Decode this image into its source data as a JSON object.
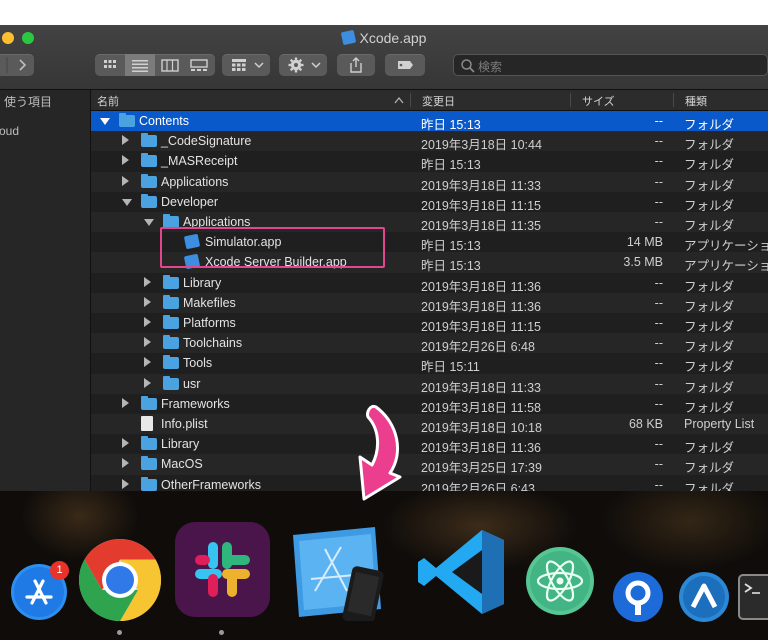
{
  "window": {
    "title": "Xcode.app",
    "search_placeholder": "検索",
    "sidebar": [
      {
        "label": "使う項目"
      },
      {
        "label": "oud"
      }
    ],
    "columns": {
      "name": "名前",
      "date": "変更日",
      "size": "サイズ",
      "kind": "種類"
    }
  },
  "rows": [
    {
      "name": "Contents",
      "date": "昨日 15:13",
      "size": "--",
      "kind": "フォルダ",
      "level": 0,
      "icon": "folder-icon",
      "state": "open",
      "selected": true
    },
    {
      "name": "_CodeSignature",
      "date": "2019年3月18日 10:44",
      "size": "--",
      "kind": "フォルダ",
      "level": 1,
      "icon": "folder-icon",
      "state": "closed"
    },
    {
      "name": "_MASReceipt",
      "date": "昨日 15:13",
      "size": "--",
      "kind": "フォルダ",
      "level": 1,
      "icon": "folder-icon",
      "state": "closed"
    },
    {
      "name": "Applications",
      "date": "2019年3月18日 11:33",
      "size": "--",
      "kind": "フォルダ",
      "level": 1,
      "icon": "folder-icon",
      "state": "closed"
    },
    {
      "name": "Developer",
      "date": "2019年3月18日 11:15",
      "size": "--",
      "kind": "フォルダ",
      "level": 1,
      "icon": "folder-icon",
      "state": "open"
    },
    {
      "name": "Applications",
      "date": "2019年3月18日 11:35",
      "size": "--",
      "kind": "フォルダ",
      "level": 2,
      "icon": "folder-icon",
      "state": "open"
    },
    {
      "name": "Simulator.app",
      "date": "昨日 15:13",
      "size": "14 MB",
      "kind": "アプリケーション",
      "level": 3,
      "icon": "app-icon",
      "state": "none"
    },
    {
      "name": "Xcode Server Builder.app",
      "date": "昨日 15:13",
      "size": "3.5 MB",
      "kind": "アプリケーション",
      "level": 3,
      "icon": "app-icon",
      "state": "none"
    },
    {
      "name": "Library",
      "date": "2019年3月18日 11:36",
      "size": "--",
      "kind": "フォルダ",
      "level": 2,
      "icon": "folder-icon",
      "state": "closed"
    },
    {
      "name": "Makefiles",
      "date": "2019年3月18日 11:36",
      "size": "--",
      "kind": "フォルダ",
      "level": 2,
      "icon": "folder-icon",
      "state": "closed"
    },
    {
      "name": "Platforms",
      "date": "2019年3月18日 11:15",
      "size": "--",
      "kind": "フォルダ",
      "level": 2,
      "icon": "folder-icon",
      "state": "closed"
    },
    {
      "name": "Toolchains",
      "date": "2019年2月26日 6:48",
      "size": "--",
      "kind": "フォルダ",
      "level": 2,
      "icon": "folder-icon",
      "state": "closed"
    },
    {
      "name": "Tools",
      "date": "昨日 15:11",
      "size": "--",
      "kind": "フォルダ",
      "level": 2,
      "icon": "folder-icon",
      "state": "closed"
    },
    {
      "name": "usr",
      "date": "2019年3月18日 11:33",
      "size": "--",
      "kind": "フォルダ",
      "level": 2,
      "icon": "folder-icon",
      "state": "closed"
    },
    {
      "name": "Frameworks",
      "date": "2019年3月18日 11:58",
      "size": "--",
      "kind": "フォルダ",
      "level": 1,
      "icon": "folder-icon",
      "state": "closed"
    },
    {
      "name": "Info.plist",
      "date": "2019年3月18日 10:18",
      "size": "68 KB",
      "kind": "Property List",
      "level": 1,
      "icon": "document-icon",
      "state": "none"
    },
    {
      "name": "Library",
      "date": "2019年3月18日 11:36",
      "size": "--",
      "kind": "フォルダ",
      "level": 1,
      "icon": "folder-icon",
      "state": "closed"
    },
    {
      "name": "MacOS",
      "date": "2019年3月25日 17:39",
      "size": "--",
      "kind": "フォルダ",
      "level": 1,
      "icon": "folder-icon",
      "state": "closed"
    },
    {
      "name": "OtherFrameworks",
      "date": "2019年2月26日 6:43",
      "size": "--",
      "kind": "フォルダ",
      "level": 1,
      "icon": "folder-icon",
      "state": "closed"
    }
  ],
  "dock": {
    "app_store_badge": "1",
    "items": [
      {
        "name": "app-store-icon"
      },
      {
        "name": "chrome-icon"
      },
      {
        "name": "slack-icon"
      },
      {
        "name": "xcode-icon"
      },
      {
        "name": "vscode-icon"
      },
      {
        "name": "atom-icon"
      },
      {
        "name": "sourcetree-icon"
      },
      {
        "name": "arrow-app-icon"
      },
      {
        "name": "terminal-icon"
      }
    ]
  },
  "colors": {
    "selection": "#0a59cb",
    "highlight_box": "#e2468c",
    "arrow": "#ec3e8e",
    "folder": "#4aa3e0"
  }
}
